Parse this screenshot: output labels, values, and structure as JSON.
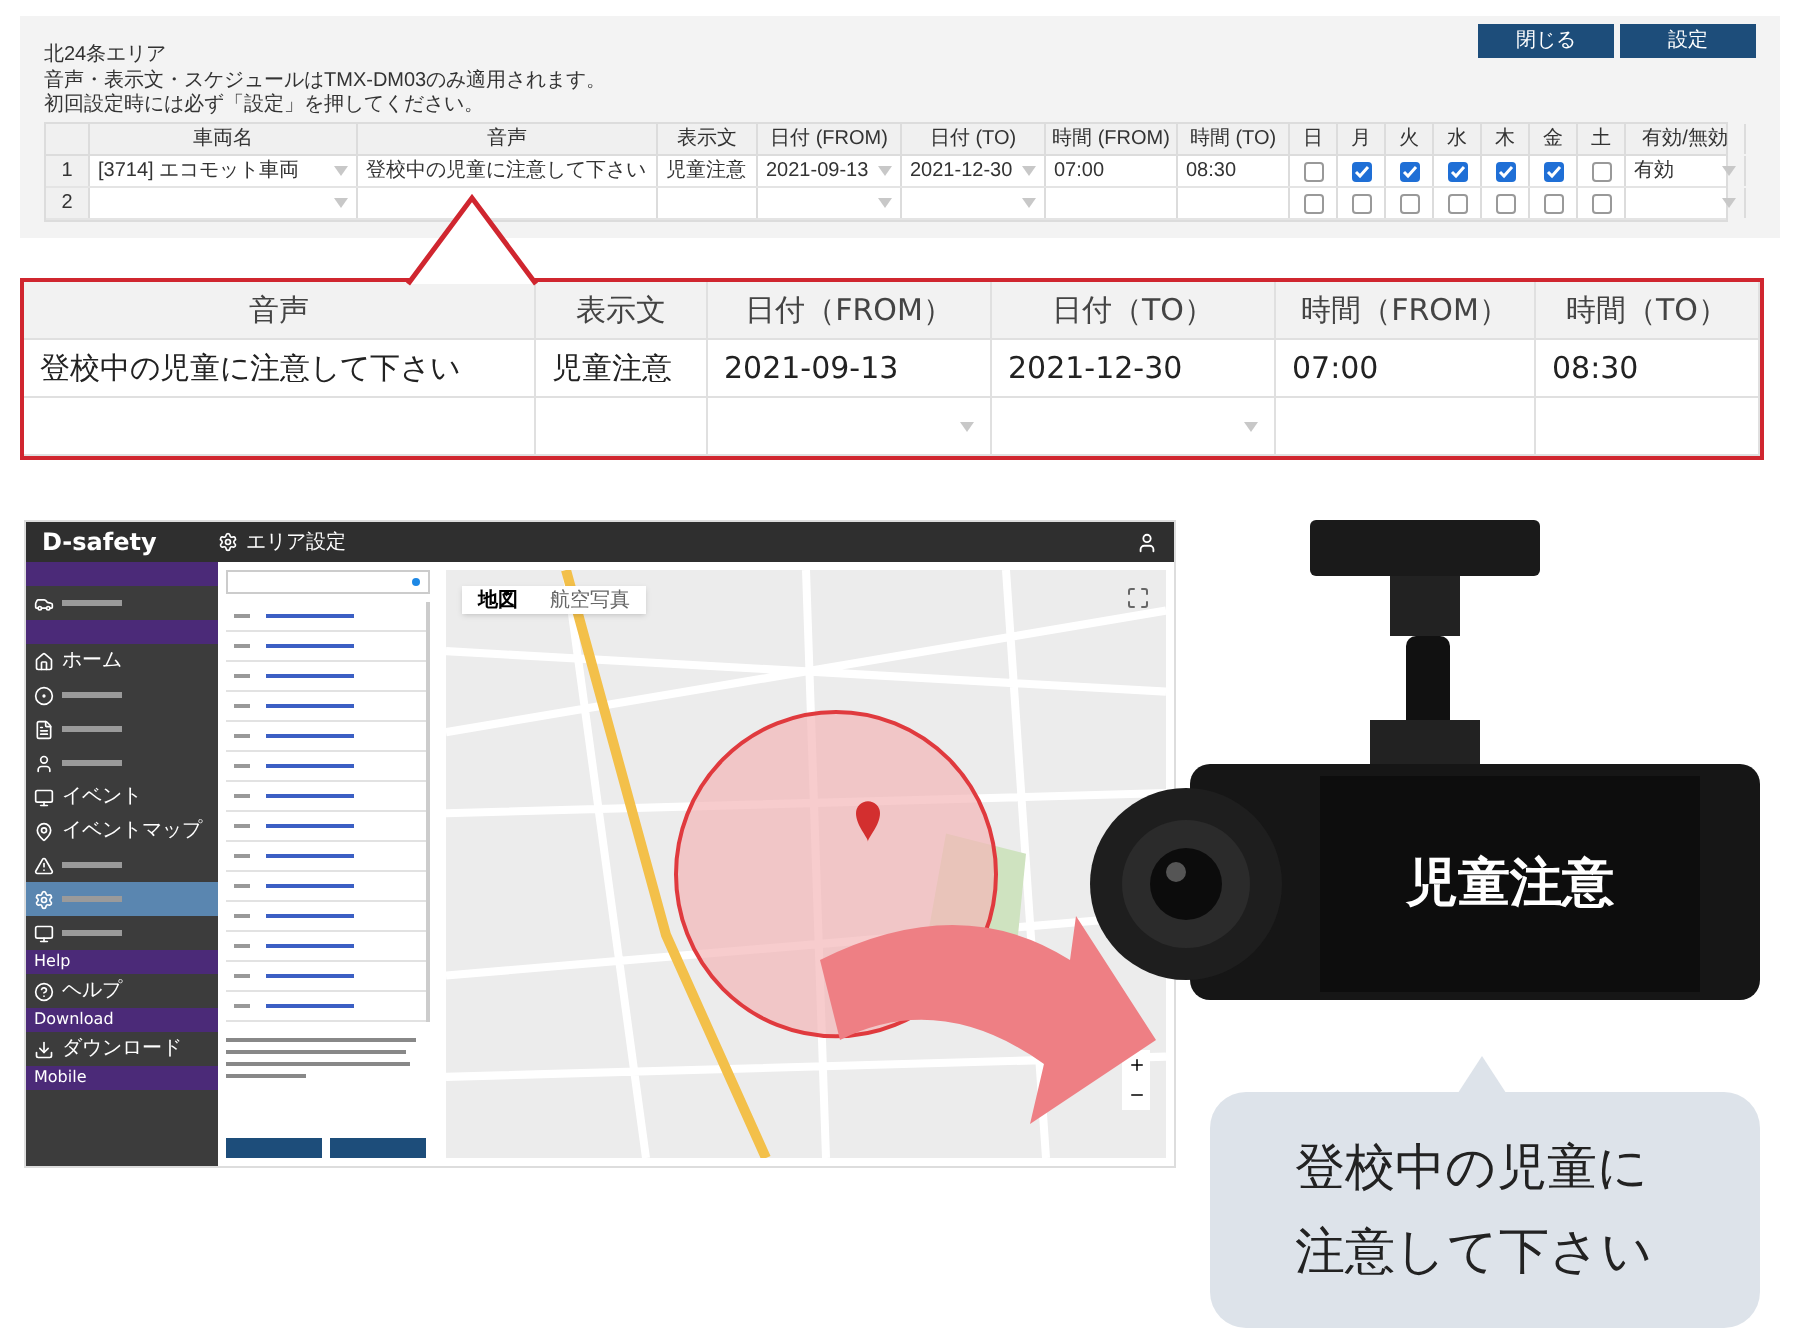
{
  "top_panel": {
    "title": "北24条エリア",
    "notes": [
      "音声・表示文・スケジュールはTMX-DM03のみ適用されます。",
      "初回設定時には必ず「設定」を押してください。"
    ],
    "buttons": [
      "閉じる",
      "設定"
    ],
    "columns": [
      "車両名",
      "音声",
      "表示文",
      "日付 (FROM)",
      "日付 (TO)",
      "時間 (FROM)",
      "時間 (TO)",
      "日",
      "月",
      "火",
      "水",
      "木",
      "金",
      "土",
      "有効/無効"
    ],
    "rows": [
      {
        "number": "1",
        "vehicle": "[3714] エコモット車両",
        "voice": "登校中の児童に注意して下さい",
        "display_text": "児童注意",
        "date_from": "2021-09-13",
        "date_to": "2021-12-30",
        "time_from": "07:00",
        "time_to": "08:30",
        "days": [
          false,
          true,
          true,
          true,
          true,
          true,
          false
        ],
        "status": "有効"
      },
      {
        "number": "2",
        "days": [
          false,
          false,
          false,
          false,
          false,
          false,
          false
        ]
      }
    ]
  },
  "callout": {
    "columns": [
      "音声",
      "表示文",
      "日付（FROM）",
      "日付（TO）",
      "時間（FROM）",
      "時間（TO）"
    ],
    "rows": [
      {
        "kind": "filled",
        "cells": [
          "登校中の児童に注意して下さい",
          "児童注意",
          "2021-09-13",
          "2021-12-30",
          "07:00",
          "08:30"
        ]
      },
      {
        "kind": "empty"
      }
    ]
  },
  "app": {
    "brand": "D-safety",
    "page_title": "エリア設定",
    "sidebar": [
      {
        "kind": "header"
      },
      {
        "kind": "item",
        "selected": false
      },
      {
        "kind": "header"
      },
      {
        "kind": "item",
        "label": "ホーム",
        "selected": false
      },
      {
        "kind": "item",
        "selected": false
      },
      {
        "kind": "item",
        "selected": false
      },
      {
        "kind": "item",
        "selected": false
      },
      {
        "kind": "item",
        "label": "イベント",
        "selected": false
      },
      {
        "kind": "item",
        "label": "イベントマップ",
        "selected": false
      },
      {
        "kind": "item",
        "selected": false
      },
      {
        "kind": "item",
        "selected": true
      },
      {
        "kind": "item",
        "selected": false
      },
      {
        "kind": "header",
        "label": "Help"
      },
      {
        "kind": "item",
        "label": "ヘルプ",
        "selected": false
      },
      {
        "kind": "header",
        "label": "Download"
      },
      {
        "kind": "item",
        "label": "ダウンロード",
        "selected": false
      },
      {
        "kind": "header",
        "label": "Mobile"
      }
    ],
    "map_tabs": [
      {
        "label": "地図",
        "selected": true
      },
      {
        "label": "航空写真",
        "selected": false
      }
    ]
  },
  "device": {
    "screen_text": "児童注意"
  },
  "bubble": {
    "text": "登校中の児童に注意して下さい"
  }
}
